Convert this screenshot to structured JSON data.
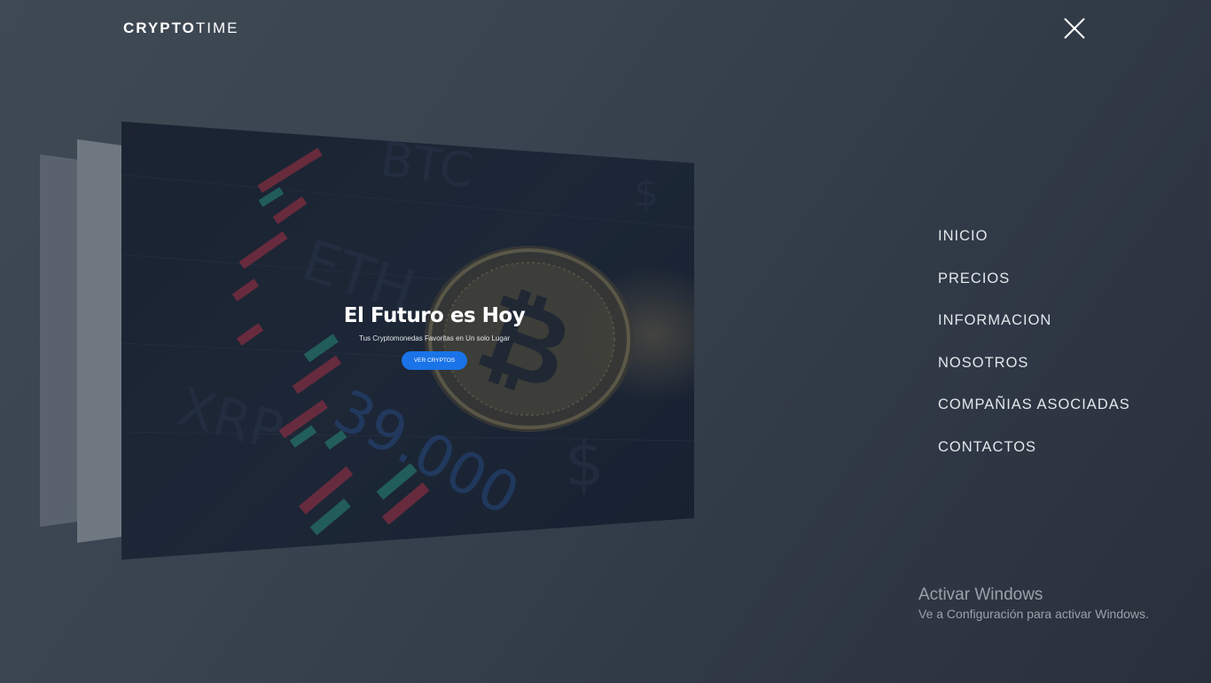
{
  "header": {
    "logo_bold": "CRYPTO",
    "logo_light": "TIME",
    "close_icon": "close-icon"
  },
  "hero": {
    "title": "El Futuro es Hoy",
    "subtitle": "Tus Cryptomonedas Favoritas en Un solo Lugar",
    "button_label": "VER CRYPTOS",
    "button_color": "#1a73e8",
    "bg_text": {
      "btc": "BTC",
      "eth": "ETH",
      "xrp": "XRP",
      "price": "39.000",
      "dollar": "$"
    }
  },
  "nav": {
    "items": [
      {
        "label": "INICIO"
      },
      {
        "label": "PRECIOS"
      },
      {
        "label": "INFORMACION"
      },
      {
        "label": "NOSOTROS"
      },
      {
        "label": "COMPAÑIAS ASOCIADAS"
      },
      {
        "label": "CONTACTOS"
      }
    ]
  },
  "watermark": {
    "title": "Activar Windows",
    "subtitle": "Ve a Configuración para activar Windows."
  },
  "colors": {
    "background": "#3a4450",
    "accent": "#1a73e8",
    "candle_red": "#c8344a",
    "candle_green": "#2fa890"
  }
}
